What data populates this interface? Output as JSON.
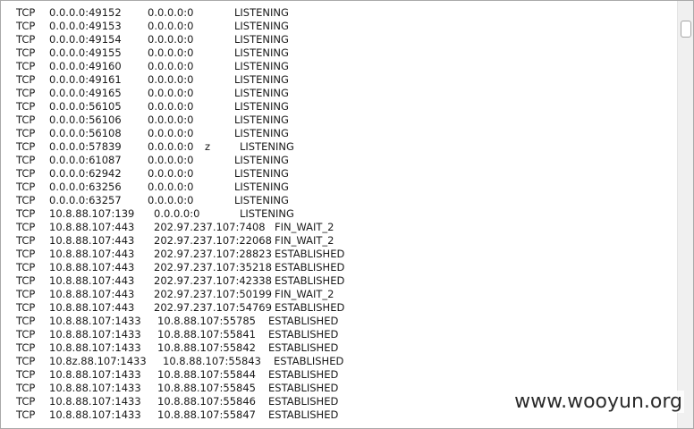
{
  "rows": [
    {
      "proto": "TCP",
      "local": "0.0.0.0:49152",
      "foreign": "0.0.0.0:0",
      "mark": "",
      "state": "LISTENING"
    },
    {
      "proto": "TCP",
      "local": "0.0.0.0:49153",
      "foreign": "0.0.0.0:0",
      "mark": "",
      "state": "LISTENING"
    },
    {
      "proto": "TCP",
      "local": "0.0.0.0:49154",
      "foreign": "0.0.0.0:0",
      "mark": "",
      "state": "LISTENING"
    },
    {
      "proto": "TCP",
      "local": "0.0.0.0:49155",
      "foreign": "0.0.0.0:0",
      "mark": "",
      "state": "LISTENING"
    },
    {
      "proto": "TCP",
      "local": "0.0.0.0:49160",
      "foreign": "0.0.0.0:0",
      "mark": "",
      "state": "LISTENING"
    },
    {
      "proto": "TCP",
      "local": "0.0.0.0:49161",
      "foreign": "0.0.0.0:0",
      "mark": "",
      "state": "LISTENING"
    },
    {
      "proto": "TCP",
      "local": "0.0.0.0:49165",
      "foreign": "0.0.0.0:0",
      "mark": "",
      "state": "LISTENING"
    },
    {
      "proto": "TCP",
      "local": "0.0.0.0:56105",
      "foreign": "0.0.0.0:0",
      "mark": "",
      "state": "LISTENING"
    },
    {
      "proto": "TCP",
      "local": "0.0.0.0:56106",
      "foreign": "0.0.0.0:0",
      "mark": "",
      "state": "LISTENING"
    },
    {
      "proto": "TCP",
      "local": "0.0.0.0:56108",
      "foreign": "0.0.0.0:0",
      "mark": "",
      "state": "LISTENING"
    },
    {
      "proto": "TCP",
      "local": "0.0.0.0:57839",
      "foreign": "0.0.0.0:0",
      "mark": "z",
      "state": "LISTENING"
    },
    {
      "proto": "TCP",
      "local": "0.0.0.0:61087",
      "foreign": "0.0.0.0:0",
      "mark": "",
      "state": "LISTENING"
    },
    {
      "proto": "TCP",
      "local": "0.0.0.0:62942",
      "foreign": "0.0.0.0:0",
      "mark": "",
      "state": "LISTENING"
    },
    {
      "proto": "TCP",
      "local": "0.0.0.0:63256",
      "foreign": "0.0.0.0:0",
      "mark": "",
      "state": "LISTENING"
    },
    {
      "proto": "TCP",
      "local": "0.0.0.0:63257",
      "foreign": "0.0.0.0:0",
      "mark": "",
      "state": "LISTENING"
    },
    {
      "proto": "TCP",
      "local": "10.8.88.107:139",
      "foreign": "0.0.0.0:0",
      "mark": "",
      "state": "LISTENING"
    },
    {
      "proto": "TCP",
      "local": "10.8.88.107:443",
      "foreign": "202.97.237.107:7408",
      "mark": "",
      "state": "FIN_WAIT_2"
    },
    {
      "proto": "TCP",
      "local": "10.8.88.107:443",
      "foreign": "202.97.237.107:22068",
      "mark": "",
      "state": "FIN_WAIT_2"
    },
    {
      "proto": "TCP",
      "local": "10.8.88.107:443",
      "foreign": "202.97.237.107:28823",
      "mark": "",
      "state": "ESTABLISHED"
    },
    {
      "proto": "TCP",
      "local": "10.8.88.107:443",
      "foreign": "202.97.237.107:35218",
      "mark": "",
      "state": "ESTABLISHED"
    },
    {
      "proto": "TCP",
      "local": "10.8.88.107:443",
      "foreign": "202.97.237.107:42338",
      "mark": "",
      "state": "ESTABLISHED"
    },
    {
      "proto": "TCP",
      "local": "10.8.88.107:443",
      "foreign": "202.97.237.107:50199",
      "mark": "",
      "state": "FIN_WAIT_2"
    },
    {
      "proto": "TCP",
      "local": "10.8.88.107:443",
      "foreign": "202.97.237.107:54769",
      "mark": "",
      "state": "ESTABLISHED"
    },
    {
      "proto": "TCP",
      "local": "10.8.88.107:1433",
      "foreign": "10.8.88.107:55785",
      "mark": "",
      "state": "ESTABLISHED"
    },
    {
      "proto": "TCP",
      "local": "10.8.88.107:1433",
      "foreign": "10.8.88.107:55841",
      "mark": "",
      "state": "ESTABLISHED"
    },
    {
      "proto": "TCP",
      "local": "10.8.88.107:1433",
      "foreign": "10.8.88.107:55842",
      "mark": "",
      "state": "ESTABLISHED"
    },
    {
      "proto": "TCP",
      "local": "10.8z.88.107:1433",
      "foreign": "10.8.88.107:55843",
      "mark": "",
      "state": "ESTABLISHED"
    },
    {
      "proto": "TCP",
      "local": "10.8.88.107:1433",
      "foreign": "10.8.88.107:55844",
      "mark": "",
      "state": "ESTABLISHED"
    },
    {
      "proto": "TCP",
      "local": "10.8.88.107:1433",
      "foreign": "10.8.88.107:55845",
      "mark": "",
      "state": "ESTABLISHED"
    },
    {
      "proto": "TCP",
      "local": "10.8.88.107:1433",
      "foreign": "10.8.88.107:55846",
      "mark": "",
      "state": "ESTABLISHED"
    },
    {
      "proto": "TCP",
      "local": "10.8.88.107:1433",
      "foreign": "10.8.88.107:55847",
      "mark": "",
      "state": "ESTABLISHED"
    }
  ],
  "watermark": "www.wooyun.org",
  "colors": {
    "text": "#1a1a1a",
    "scrollbar_track": "#f0f0f0"
  }
}
